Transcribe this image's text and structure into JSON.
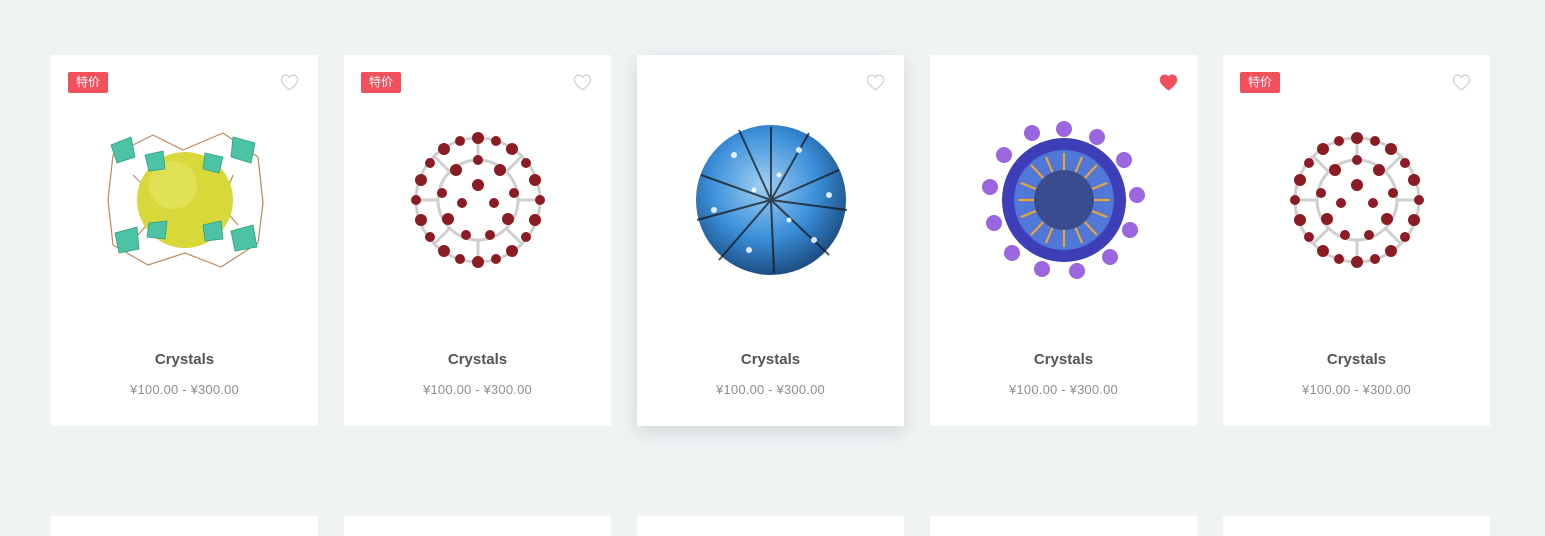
{
  "colors": {
    "background": "#eff3f4",
    "badge": "#f3505e",
    "favorite_active": "#f3505e",
    "favorite_inactive": "#d0d0d0"
  },
  "products": [
    {
      "badge": "特价",
      "favorited": false,
      "image": "mof-crystal-image",
      "name": "Crystals",
      "price": "¥100.00 - ¥300.00"
    },
    {
      "badge": "特价",
      "favorited": false,
      "image": "fullerene-image",
      "name": "Crystals",
      "price": "¥100.00 - ¥300.00"
    },
    {
      "badge": "",
      "favorited": false,
      "image": "blue-nanoparticle-image",
      "name": "Crystals",
      "price": "¥100.00 - ¥300.00"
    },
    {
      "badge": "",
      "favorited": true,
      "image": "purple-micelle-image",
      "name": "Crystals",
      "price": "¥100.00 - ¥300.00"
    },
    {
      "badge": "特价",
      "favorited": false,
      "image": "fullerene-image",
      "name": "Crystals",
      "price": "¥100.00 - ¥300.00"
    }
  ]
}
